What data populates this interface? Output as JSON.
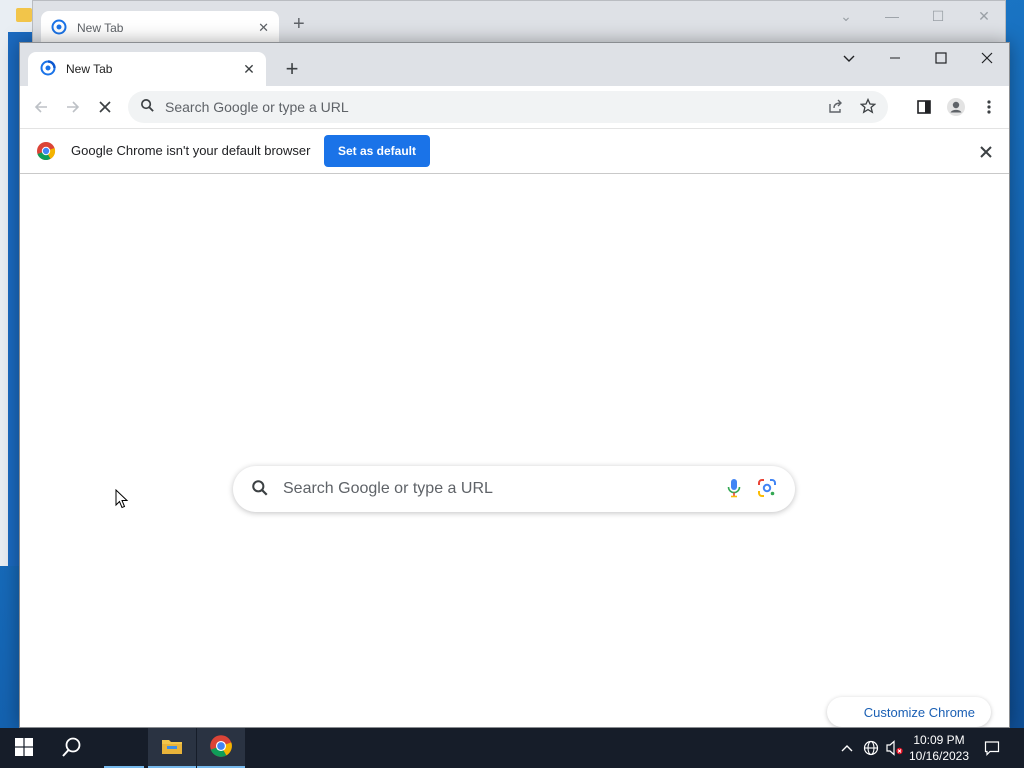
{
  "background_window": {
    "tab_title": "New Tab"
  },
  "window": {
    "tab_title": "New Tab"
  },
  "omnibox": {
    "placeholder": "Search Google or type a URL"
  },
  "infobar": {
    "message": "Google Chrome isn't your default browser",
    "button_label": "Set as default"
  },
  "ntp": {
    "search_placeholder": "Search Google or type a URL",
    "customize_label": "Customize Chrome"
  },
  "taskbar": {
    "time": "10:09 PM",
    "date": "10/16/2023"
  },
  "colors": {
    "accent": "#1a73e8",
    "titlebar": "#dee1e6",
    "taskbar": "#161d29"
  }
}
